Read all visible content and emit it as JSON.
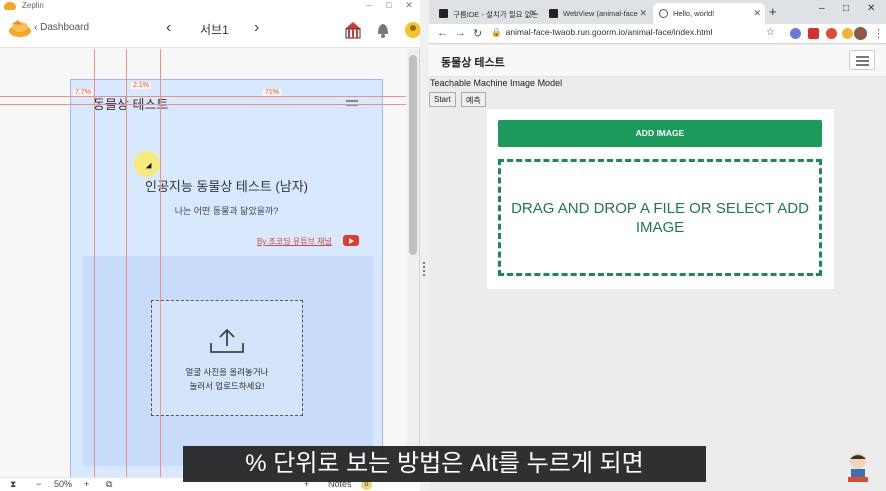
{
  "zeplin": {
    "window_title": "Zeplin",
    "back_label": "Dashboard",
    "screen_title": "서브1",
    "zoom": "50%",
    "notes_label": "Notes",
    "notes_count": "0",
    "measurements": [
      "7.7%",
      "2.1%",
      "71%"
    ],
    "artboard": {
      "title": "동물상 테스트",
      "heading": "인공지능 동물상 테스트 (남자)",
      "subheading": "나는 어떤 동물과 닮았을까?",
      "youtube_link": "By 조코딩 유튜브 채널",
      "upload_line1": "얼굴 사진을 올려놓거나",
      "upload_line2": "눌러서 업로드하세요!"
    }
  },
  "chrome": {
    "tabs": [
      {
        "label": "구름IDE - 설치가 필요 없는",
        "active": false
      },
      {
        "label": "WebView (animal-face",
        "active": false
      },
      {
        "label": "Hello, world!",
        "active": true
      }
    ],
    "url": "animal-face-twaob.run.goorm.io/animal-face/index.html",
    "page": {
      "brand": "동물상 테스트",
      "tm_title": "Teachable Machine Image Model",
      "start_button": "Start",
      "predict_button": "예측",
      "add_image_button": "ADD IMAGE",
      "dropzone_text": "DRAG AND DROP A FILE OR SELECT ADD IMAGE"
    }
  },
  "subtitle": "% 단위로 보는 방법은 Alt를 누르게 되면",
  "colors": {
    "accent_green": "#1b9a5b",
    "dropzone_border": "#1b8a4f",
    "zeplin_orange": "#f6a623",
    "guide_red": "#f18f86"
  }
}
